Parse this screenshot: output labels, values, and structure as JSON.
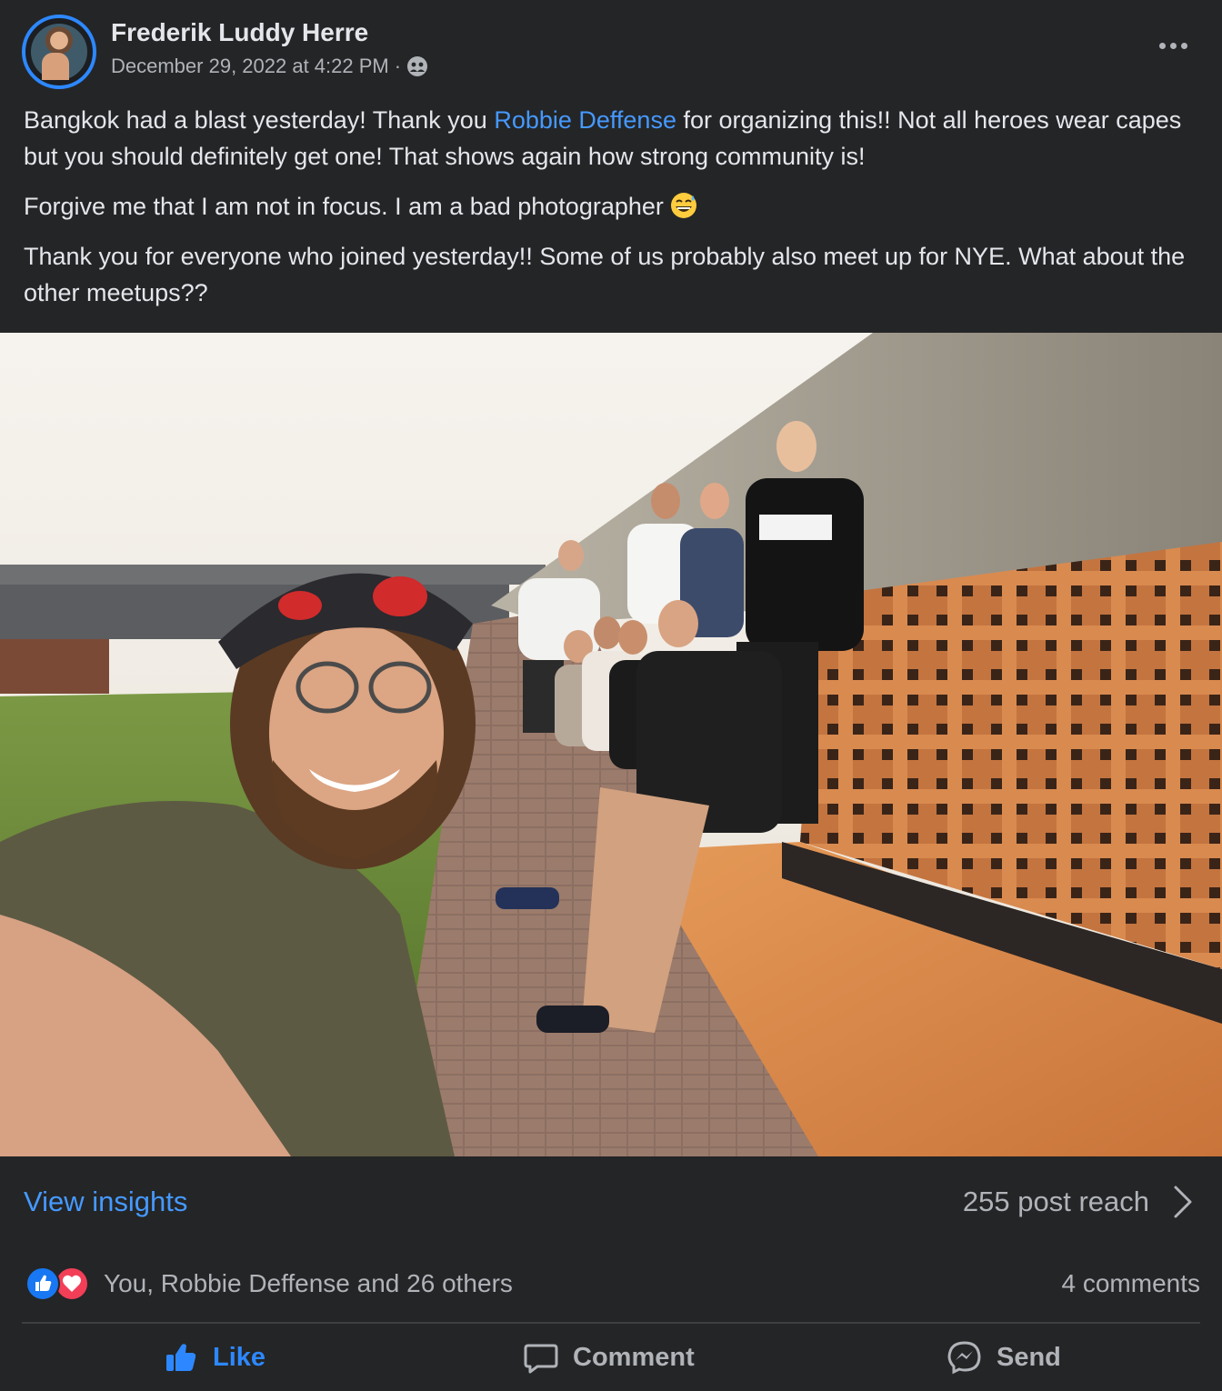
{
  "post": {
    "author": "Frederik Luddy Herre",
    "date": "December 29, 2022 at 4:22 PM",
    "dot": "·",
    "audience_icon": "friends-icon",
    "paragraph1_before": "Bangkok had a blast yesterday! Thank you ",
    "mention": "Robbie Deffense",
    "paragraph1_after": " for organizing this!! Not all heroes wear capes but you should definitely get one! That shows again how strong community is!",
    "paragraph2": "Forgive me that I am not in focus. I am a bad photographer",
    "paragraph2_emoji": "grinning-sweat-emoji",
    "paragraph3": "Thank you for everyone who joined yesterday!! Some of us probably also meet up for NYE. What about the other meetups??"
  },
  "insights": {
    "view_label": "View insights",
    "reach_label": "255 post reach"
  },
  "engagement": {
    "reactions_text": "You, Robbie Deffense and 26 others",
    "comments_text": "4 comments"
  },
  "actions": {
    "like": "Like",
    "comment": "Comment",
    "send": "Send"
  },
  "colors": {
    "background": "#242526",
    "link": "#4599ff",
    "like_active": "#2d88ff",
    "secondary_text": "#b0b3b8"
  }
}
